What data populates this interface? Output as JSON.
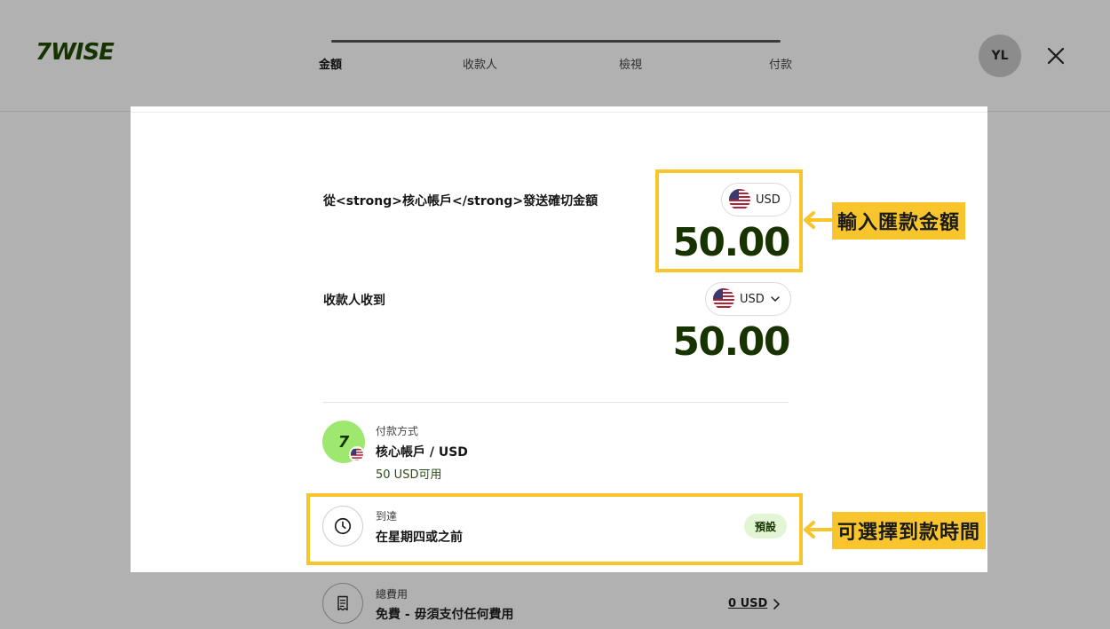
{
  "header": {
    "logo": "7WISE",
    "steps": [
      "金額",
      "收款人",
      "檢視",
      "付款"
    ],
    "active_step": 0,
    "avatar_initials": "YL"
  },
  "send": {
    "label": "從<strong>核心帳戶</strong>發送確切金額",
    "currency": "USD",
    "amount": "50.00"
  },
  "receive": {
    "label": "收款人收到",
    "currency": "USD",
    "amount": "50.00"
  },
  "payment_method": {
    "label": "付款方式",
    "title": "核心帳戶 / USD",
    "sub": "50 USD可用"
  },
  "arrival": {
    "label": "到達",
    "title": "在星期四或之前",
    "badge": "預設"
  },
  "fees": {
    "label": "總費用",
    "title": "免費 - 毋須支付任何費用",
    "amount": "0 USD"
  },
  "annotations": {
    "amount_callout": "輸入匯款金額",
    "arrival_callout": "可選擇到款時間",
    "highlight_color": "#f8c52c"
  },
  "colors": {
    "brand_green": "#163300",
    "bright_green": "#9fe870",
    "overlay_gray": "#b1b1b1"
  },
  "icons": [
    "close-icon",
    "chevron-down-icon",
    "clock-icon",
    "receipt-icon",
    "chevron-right-icon",
    "us-flag-icon",
    "arrow-left-icon"
  ]
}
